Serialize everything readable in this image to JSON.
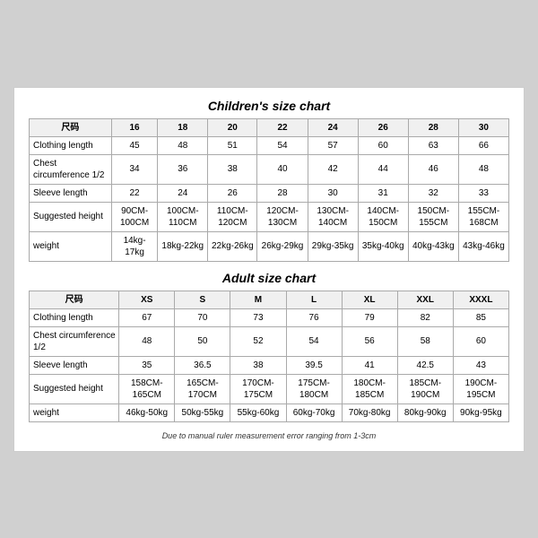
{
  "children_chart": {
    "title": "Children's size chart",
    "columns": [
      "尺码",
      "16",
      "18",
      "20",
      "22",
      "24",
      "26",
      "28",
      "30"
    ],
    "rows": [
      {
        "label": "Clothing length",
        "values": [
          "45",
          "48",
          "51",
          "54",
          "57",
          "60",
          "63",
          "66"
        ]
      },
      {
        "label": "Chest circumference 1/2",
        "values": [
          "34",
          "36",
          "38",
          "40",
          "42",
          "44",
          "46",
          "48"
        ]
      },
      {
        "label": "Sleeve length",
        "values": [
          "22",
          "24",
          "26",
          "28",
          "30",
          "31",
          "32",
          "33"
        ]
      },
      {
        "label": "Suggested height",
        "values": [
          "90CM-100CM",
          "100CM-110CM",
          "110CM-120CM",
          "120CM-130CM",
          "130CM-140CM",
          "140CM-150CM",
          "150CM-155CM",
          "155CM-168CM"
        ]
      },
      {
        "label": "weight",
        "values": [
          "14kg-17kg",
          "18kg-22kg",
          "22kg-26kg",
          "26kg-29kg",
          "29kg-35kg",
          "35kg-40kg",
          "40kg-43kg",
          "43kg-46kg"
        ]
      }
    ]
  },
  "adult_chart": {
    "title": "Adult size chart",
    "columns": [
      "尺码",
      "XS",
      "S",
      "M",
      "L",
      "XL",
      "XXL",
      "XXXL"
    ],
    "rows": [
      {
        "label": "Clothing length",
        "values": [
          "67",
          "70",
          "73",
          "76",
          "79",
          "82",
          "85"
        ]
      },
      {
        "label": "Chest circumference 1/2",
        "values": [
          "48",
          "50",
          "52",
          "54",
          "56",
          "58",
          "60"
        ]
      },
      {
        "label": "Sleeve length",
        "values": [
          "35",
          "36.5",
          "38",
          "39.5",
          "41",
          "42.5",
          "43"
        ]
      },
      {
        "label": "Suggested height",
        "values": [
          "158CM-165CM",
          "165CM-170CM",
          "170CM-175CM",
          "175CM-180CM",
          "180CM-185CM",
          "185CM-190CM",
          "190CM-195CM"
        ]
      },
      {
        "label": "weight",
        "values": [
          "46kg-50kg",
          "50kg-55kg",
          "55kg-60kg",
          "60kg-70kg",
          "70kg-80kg",
          "80kg-90kg",
          "90kg-95kg"
        ]
      }
    ]
  },
  "footer": "Due to manual ruler measurement error ranging from 1-3cm"
}
